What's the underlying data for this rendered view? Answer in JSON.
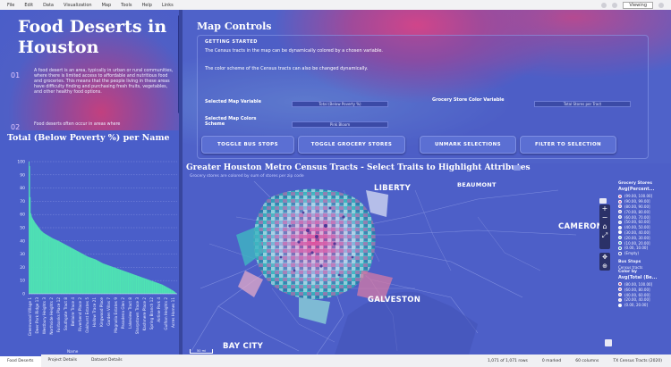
{
  "menubar": {
    "items": [
      "File",
      "Edit",
      "Data",
      "Visualization",
      "Map",
      "Tools",
      "Help",
      "Links"
    ],
    "right_select": "Viewing"
  },
  "story": {
    "title": "Food Deserts in Houston",
    "num1": "01",
    "p1": "A food desert is an area, typically in urban or rural communities, where there is limited access to affordable and nutritious food and groceries. This means that the people living in these areas have difficulty finding and purchasing fresh fruits, vegetables, and other healthy food options.",
    "num2": "02",
    "p2": "Food deserts often occur in areas where"
  },
  "chart_data": {
    "type": "bar",
    "title": "Total (Below Poverty %) per Name",
    "ylim": [
      0,
      100
    ],
    "yticks": [
      0,
      10,
      20,
      30,
      40,
      50,
      60,
      70,
      80,
      90,
      100
    ],
    "xlabel": "Name",
    "bar_color": "#4fe3b4",
    "profile": [
      [
        0,
        100
      ],
      [
        0.005,
        96
      ],
      [
        0.01,
        62
      ],
      [
        0.02,
        58
      ],
      [
        0.03,
        56
      ],
      [
        0.04,
        54
      ],
      [
        0.06,
        51
      ],
      [
        0.08,
        48
      ],
      [
        0.1,
        46
      ],
      [
        0.13,
        44
      ],
      [
        0.16,
        42
      ],
      [
        0.2,
        40
      ],
      [
        0.25,
        37
      ],
      [
        0.3,
        34
      ],
      [
        0.35,
        31
      ],
      [
        0.4,
        28
      ],
      [
        0.45,
        26
      ],
      [
        0.5,
        23
      ],
      [
        0.55,
        21
      ],
      [
        0.6,
        19
      ],
      [
        0.65,
        17
      ],
      [
        0.7,
        15
      ],
      [
        0.75,
        13
      ],
      [
        0.8,
        11
      ],
      [
        0.85,
        9
      ],
      [
        0.9,
        7
      ],
      [
        0.95,
        4
      ],
      [
        0.98,
        2
      ],
      [
        1,
        0
      ]
    ],
    "categories": [
      "Greenwood Village 1",
      "Deer Park Ridge 13",
      "Westbury Heights 3",
      "Northside Heights 2",
      "Fairbanks Place 12",
      "Southgate Tract 8",
      "Bellaire Trace 4",
      "Riverbend Place 2",
      "Oakhurst Estates 5",
      "Hollow Trace 21",
      "Kingwood Place",
      "Garden Villas 7",
      "Magnolia Estates 9",
      "Pasadena Glen 2",
      "Lakeview Tract 8",
      "Sharpstown Trace 3",
      "Kashmere Place 2",
      "Spring Branch 12",
      "Airline Park 4",
      "Gulfton Heights 2",
      "Acres Homes 11"
    ]
  },
  "controls": {
    "title": "Map Controls",
    "getting_started": "GETTING STARTED",
    "p1": "The Census tracts in the map can be dynamically colored by a chosen variable.",
    "p2": "The color scheme of the Census tracts can also be changed dynamically.",
    "selected_map_variable_label": "Selected Map Variable",
    "selected_map_variable_value": "Total (Below Poverty %)",
    "selected_map_colors_label": "Selected Map Colors Scheme",
    "selected_map_colors_value": "Pink Bloom",
    "grocery_color_label": "Grocery Store Color Variable",
    "grocery_color_value": "Total Stores per Tract",
    "buttons": [
      "TOGGLE BUS STOPS",
      "TOGGLE GROCERY STORES",
      "UNMARK SELECTIONS",
      "FILTER TO SELECTION"
    ]
  },
  "map": {
    "title": "Greater Houston Metro Census Tracts - Select Traits to Highlight Attributes",
    "subtitle": "Grocery stores are colored by sum of stores per zip code",
    "places": {
      "liberty": "LIBERTY",
      "beaumont": "BEAUMONT",
      "cameron": "CAMERON",
      "galveston": "GALVESTON",
      "bay_city": "BAY CITY"
    },
    "zoom_in": "+",
    "zoom_out": "−",
    "scale": "50 mi"
  },
  "legend": {
    "head1": "Grocery Stores",
    "title1": "Avg(Percent...",
    "items1": [
      {
        "label": "(99.00, 100.00]",
        "color": "#e04f9a"
      },
      {
        "label": "(90.00, 99.00]",
        "color": "#d658a6"
      },
      {
        "label": "(80.00, 90.00]",
        "color": "#c97fc2"
      },
      {
        "label": "(70.00, 80.00]",
        "color": "#b9a1d6"
      },
      {
        "label": "(60.00, 70.00]",
        "color": "#a9b7e0"
      },
      {
        "label": "(50.00, 60.00]",
        "color": "#c6d5ee"
      },
      {
        "label": "(40.00, 50.00]",
        "color": "#e1e7f6"
      },
      {
        "label": "(30.00, 40.00]",
        "color": "#ffffff"
      },
      {
        "label": "(20.00, 30.00]",
        "color": "#8fd8d8"
      },
      {
        "label": "(10.00, 20.00]",
        "color": "#3fb7c2"
      },
      {
        "label": "(0.00, 10.00]",
        "color": "#2a8fb3"
      },
      {
        "label": "(Empty)",
        "color": "#3b4aa6"
      }
    ],
    "head2": "Bus Stops",
    "bus_label": "Census tracts",
    "head3": "Color by",
    "title2": "Avg(Total (Be...",
    "items2": [
      {
        "label": "(80.00, 100.00]",
        "color": "#c2407f"
      },
      {
        "label": "(60.00, 80.00]",
        "color": "#d47aa6"
      },
      {
        "label": "(40.00, 60.00]",
        "color": "#e4aac8"
      },
      {
        "label": "(20.00, 40.00]",
        "color": "#f0d2e2"
      },
      {
        "label": "(0.00, 20.00]",
        "color": "#ffffff"
      }
    ]
  },
  "status": {
    "tabs": [
      "Food Deserts",
      "Project Details",
      "Dataset Details"
    ],
    "rows": "1,071 of 1,071 rows",
    "marked": "0 marked",
    "columns": "60 columns",
    "table": "TX Census Tracts (2020)"
  }
}
